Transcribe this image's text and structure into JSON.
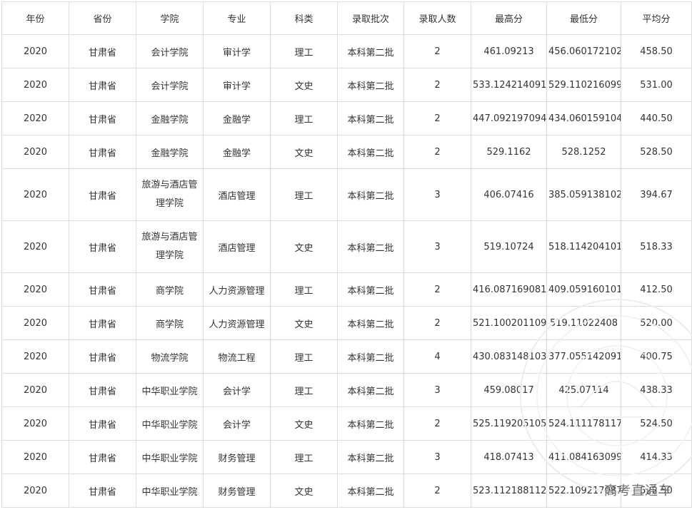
{
  "table": {
    "headers": [
      "年份",
      "省份",
      "学院",
      "专业",
      "科类",
      "录取批次",
      "录取人数",
      "最高分",
      "最低分",
      "平均分"
    ],
    "rows": [
      [
        "2020",
        "甘肃省",
        "会计学院",
        "审计学",
        "理工",
        "本科第二批",
        "2",
        "461.09213",
        "456.060172102",
        "458.50"
      ],
      [
        "2020",
        "甘肃省",
        "会计学院",
        "审计学",
        "文史",
        "本科第二批",
        "2",
        "533.124214091",
        "529.110216099",
        "531.00"
      ],
      [
        "2020",
        "甘肃省",
        "金融学院",
        "金融学",
        "理工",
        "本科第二批",
        "2",
        "447.092197094",
        "434.060159104",
        "440.50"
      ],
      [
        "2020",
        "甘肃省",
        "金融学院",
        "金融学",
        "文史",
        "本科第二批",
        "2",
        "529.1162",
        "528.1252",
        "528.50"
      ],
      [
        "2020",
        "甘肃省",
        "旅游与酒店管理学院",
        "酒店管理",
        "理工",
        "本科第二批",
        "3",
        "406.07416",
        "385.059138102",
        "394.67"
      ],
      [
        "2020",
        "甘肃省",
        "旅游与酒店管理学院",
        "酒店管理",
        "文史",
        "本科第二批",
        "3",
        "519.10724",
        "518.114204101",
        "518.33"
      ],
      [
        "2020",
        "甘肃省",
        "商学院",
        "人力资源管理",
        "理工",
        "本科第二批",
        "2",
        "416.087169081",
        "409.059160101",
        "412.50"
      ],
      [
        "2020",
        "甘肃省",
        "商学院",
        "人力资源管理",
        "文史",
        "本科第二批",
        "2",
        "521.100201109",
        "519.11022408",
        "520.00"
      ],
      [
        "2020",
        "甘肃省",
        "物流学院",
        "物流工程",
        "理工",
        "本科第二批",
        "4",
        "430.083148103",
        "377.055142091",
        "400.75"
      ],
      [
        "2020",
        "甘肃省",
        "中华职业学院",
        "会计学",
        "理工",
        "本科第二批",
        "3",
        "459.08017",
        "425.07114",
        "438.33"
      ],
      [
        "2020",
        "甘肃省",
        "中华职业学院",
        "会计学",
        "文史",
        "本科第二批",
        "2",
        "525.119205105",
        "524.111178117",
        "524.50"
      ],
      [
        "2020",
        "甘肃省",
        "中华职业学院",
        "财务管理",
        "理工",
        "本科第二批",
        "3",
        "418.07413",
        "411.084163099",
        "414.33"
      ],
      [
        "2020",
        "甘肃省",
        "中华职业学院",
        "财务管理",
        "文史",
        "本科第二批",
        "2",
        "523.112188112",
        "522.109217087",
        "522.50"
      ]
    ]
  },
  "watermark": {
    "text": "高考直通车"
  }
}
